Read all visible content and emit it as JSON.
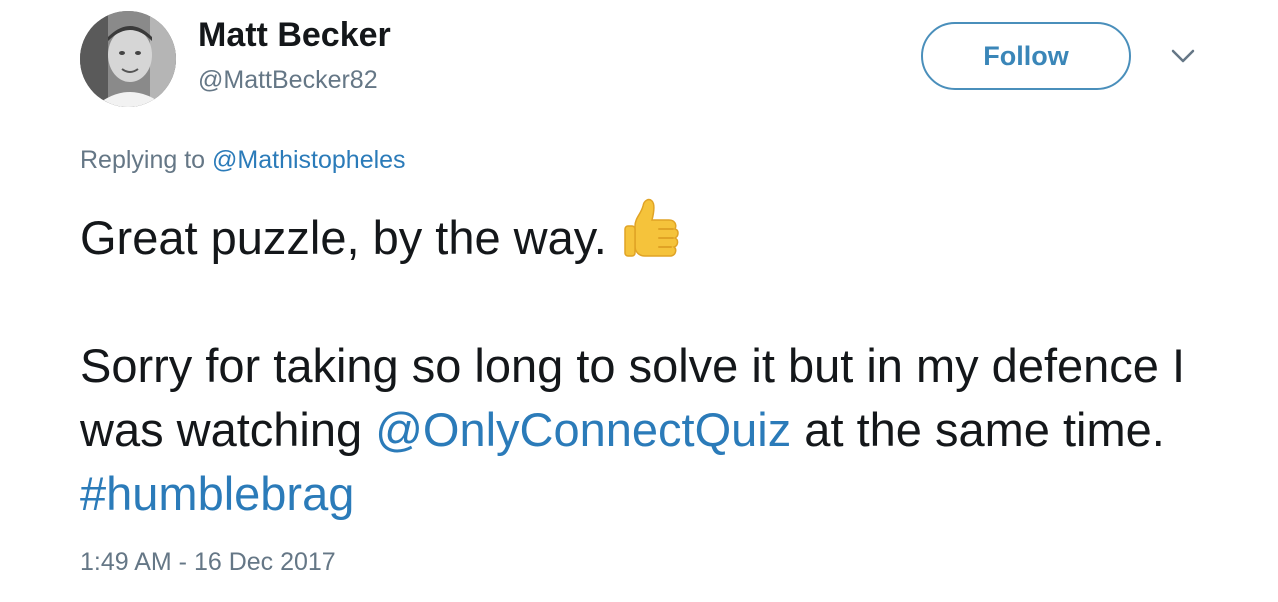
{
  "user": {
    "name": "Matt Becker",
    "handle": "@MattBecker82"
  },
  "follow_button": {
    "label": "Follow"
  },
  "reply": {
    "prefix": "Replying to ",
    "mention": "@Mathistopheles"
  },
  "tweet": {
    "line1": "Great puzzle, by the way.",
    "line2_text": "Sorry for taking so long to solve it but in my defence I was watching ",
    "line2_mention": "@OnlyConnectQuiz",
    "line2_after": " at the same time. ",
    "hashtag": "#humblebrag"
  },
  "timestamp": "1:49 AM - 16 Dec 2017",
  "icons": {
    "avatar": "profile-photo",
    "chevron": "chevron-down-icon",
    "emoji": "thumbs-up-icon"
  },
  "colors": {
    "link": "#2b7bb9",
    "follow_border": "#4a8fbb",
    "secondary_text": "#657786",
    "primary_text": "#14171a"
  }
}
